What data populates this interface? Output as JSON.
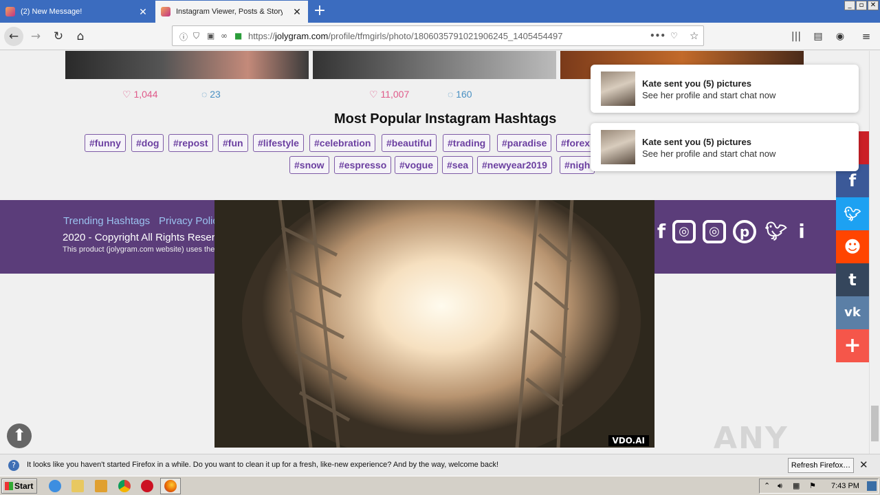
{
  "browser": {
    "tabs": [
      {
        "title": "(2) New Message!",
        "active": false
      },
      {
        "title": "Instagram Viewer, Posts & Story Vi",
        "active": true
      }
    ],
    "url_prefix": "https://",
    "url_domain": "jolygram.com",
    "url_path": "/profile/tfmgirls/photo/1806035791021906245_1405454497"
  },
  "posts": [
    {
      "likes": "1,044",
      "comments": "23"
    },
    {
      "likes": "11,007",
      "comments": "160"
    }
  ],
  "hashtags": {
    "title": "Most Popular Instagram Hashtags",
    "row1": [
      "#funny",
      "#dog",
      "#repost",
      "#fun",
      "#lifestyle",
      "#celebration",
      "#beautiful",
      "#trading",
      "#paradise",
      "#forex"
    ],
    "row2": [
      "#snow",
      "#espresso",
      "#vogue",
      "#sea",
      "#newyear2019",
      "#nigh"
    ]
  },
  "footer": {
    "links": [
      "Trending Hashtags",
      "Privacy Polic"
    ],
    "copyright": "2020 - Copyright All Rights Reserv",
    "product": "This product (jolygram.com website) uses the"
  },
  "video": {
    "badge": "VDO.AI"
  },
  "notifications": [
    {
      "title": "Kate sent you (5) pictures",
      "text": "See her profile and start chat now"
    },
    {
      "title": "Kate sent you (5) pictures",
      "text": "See her profile and start chat now"
    }
  ],
  "share_colors": {
    "pinterest": "#cb2027",
    "facebook": "#3b5998",
    "twitter": "#1da1f2",
    "reddit": "#ff4500",
    "tumblr": "#35465c",
    "vk": "#5b7fa6",
    "more": "#f5564a"
  },
  "watermark": "ANY RUN",
  "firefox_bar": {
    "message": "It looks like you haven't started Firefox in a while. Do you want to clean it up for a fresh, like-new experience? And by the way, welcome back!",
    "button": "Refresh Firefox…"
  },
  "taskbar": {
    "start": "Start",
    "time": "7:43 PM"
  }
}
